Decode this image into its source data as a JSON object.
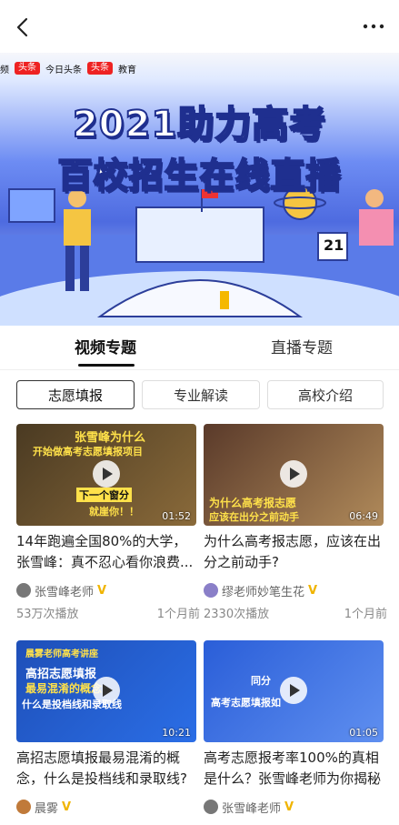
{
  "header": {
    "back_icon": "back-arrow-icon",
    "more_icon": "more-dots-icon"
  },
  "banner": {
    "brand_label": "频",
    "brand_badge": "头条",
    "brand_name": "今日头条",
    "brand_badge2": "头条",
    "brand_sub": "教育",
    "title_line1": "2021助力高考",
    "title_line2": "百校招生在线直播",
    "calendar_number": "21"
  },
  "tabs": [
    {
      "label": "视频专题",
      "active": true
    },
    {
      "label": "直播专题",
      "active": false
    }
  ],
  "chips": [
    {
      "label": "志愿填报",
      "active": true
    },
    {
      "label": "专业解读",
      "active": false
    },
    {
      "label": "高校介绍",
      "active": false
    }
  ],
  "videos": [
    {
      "thumb_text1": "张雪峰为什么",
      "thumb_text2": "开始做高考志愿填报项目",
      "thumb_text3": "下一个窗分",
      "thumb_text4": "就崖你！！",
      "duration": "01:52",
      "title": "14年跑遍全国80%的大学，张雪峰：真不忍心看你浪费...",
      "author": "张雪峰老师",
      "verified": "V",
      "views": "53万次播放",
      "time": "1个月前"
    },
    {
      "thumb_text1": "为什么高考报志愿",
      "thumb_text2": "应该在出分之前动手",
      "duration": "06:49",
      "title": "为什么高考报志愿，应该在出分之前动手?",
      "author": "缪老师妙笔生花",
      "verified": "V",
      "views": "2330次播放",
      "time": "1个月前"
    },
    {
      "thumb_text1": "晨雾老师高考讲座",
      "thumb_text2": "高招志愿填报",
      "thumb_text3": "最易混淆的概念",
      "thumb_text4": "什么是投档线和录取线",
      "duration": "10:21",
      "title": "高招志愿填报最易混淆的概念，什么是投档线和录取线?",
      "author": "晨雾",
      "verified": "V",
      "views": "",
      "time": ""
    },
    {
      "thumb_text1": "同分",
      "thumb_text2": "高考志愿填报如",
      "duration": "01:05",
      "title": "高考志愿报考率100%的真相是什么？张雪峰老师为你揭秘",
      "author": "张雪峰老师",
      "verified": "V",
      "views": "",
      "time": ""
    }
  ]
}
